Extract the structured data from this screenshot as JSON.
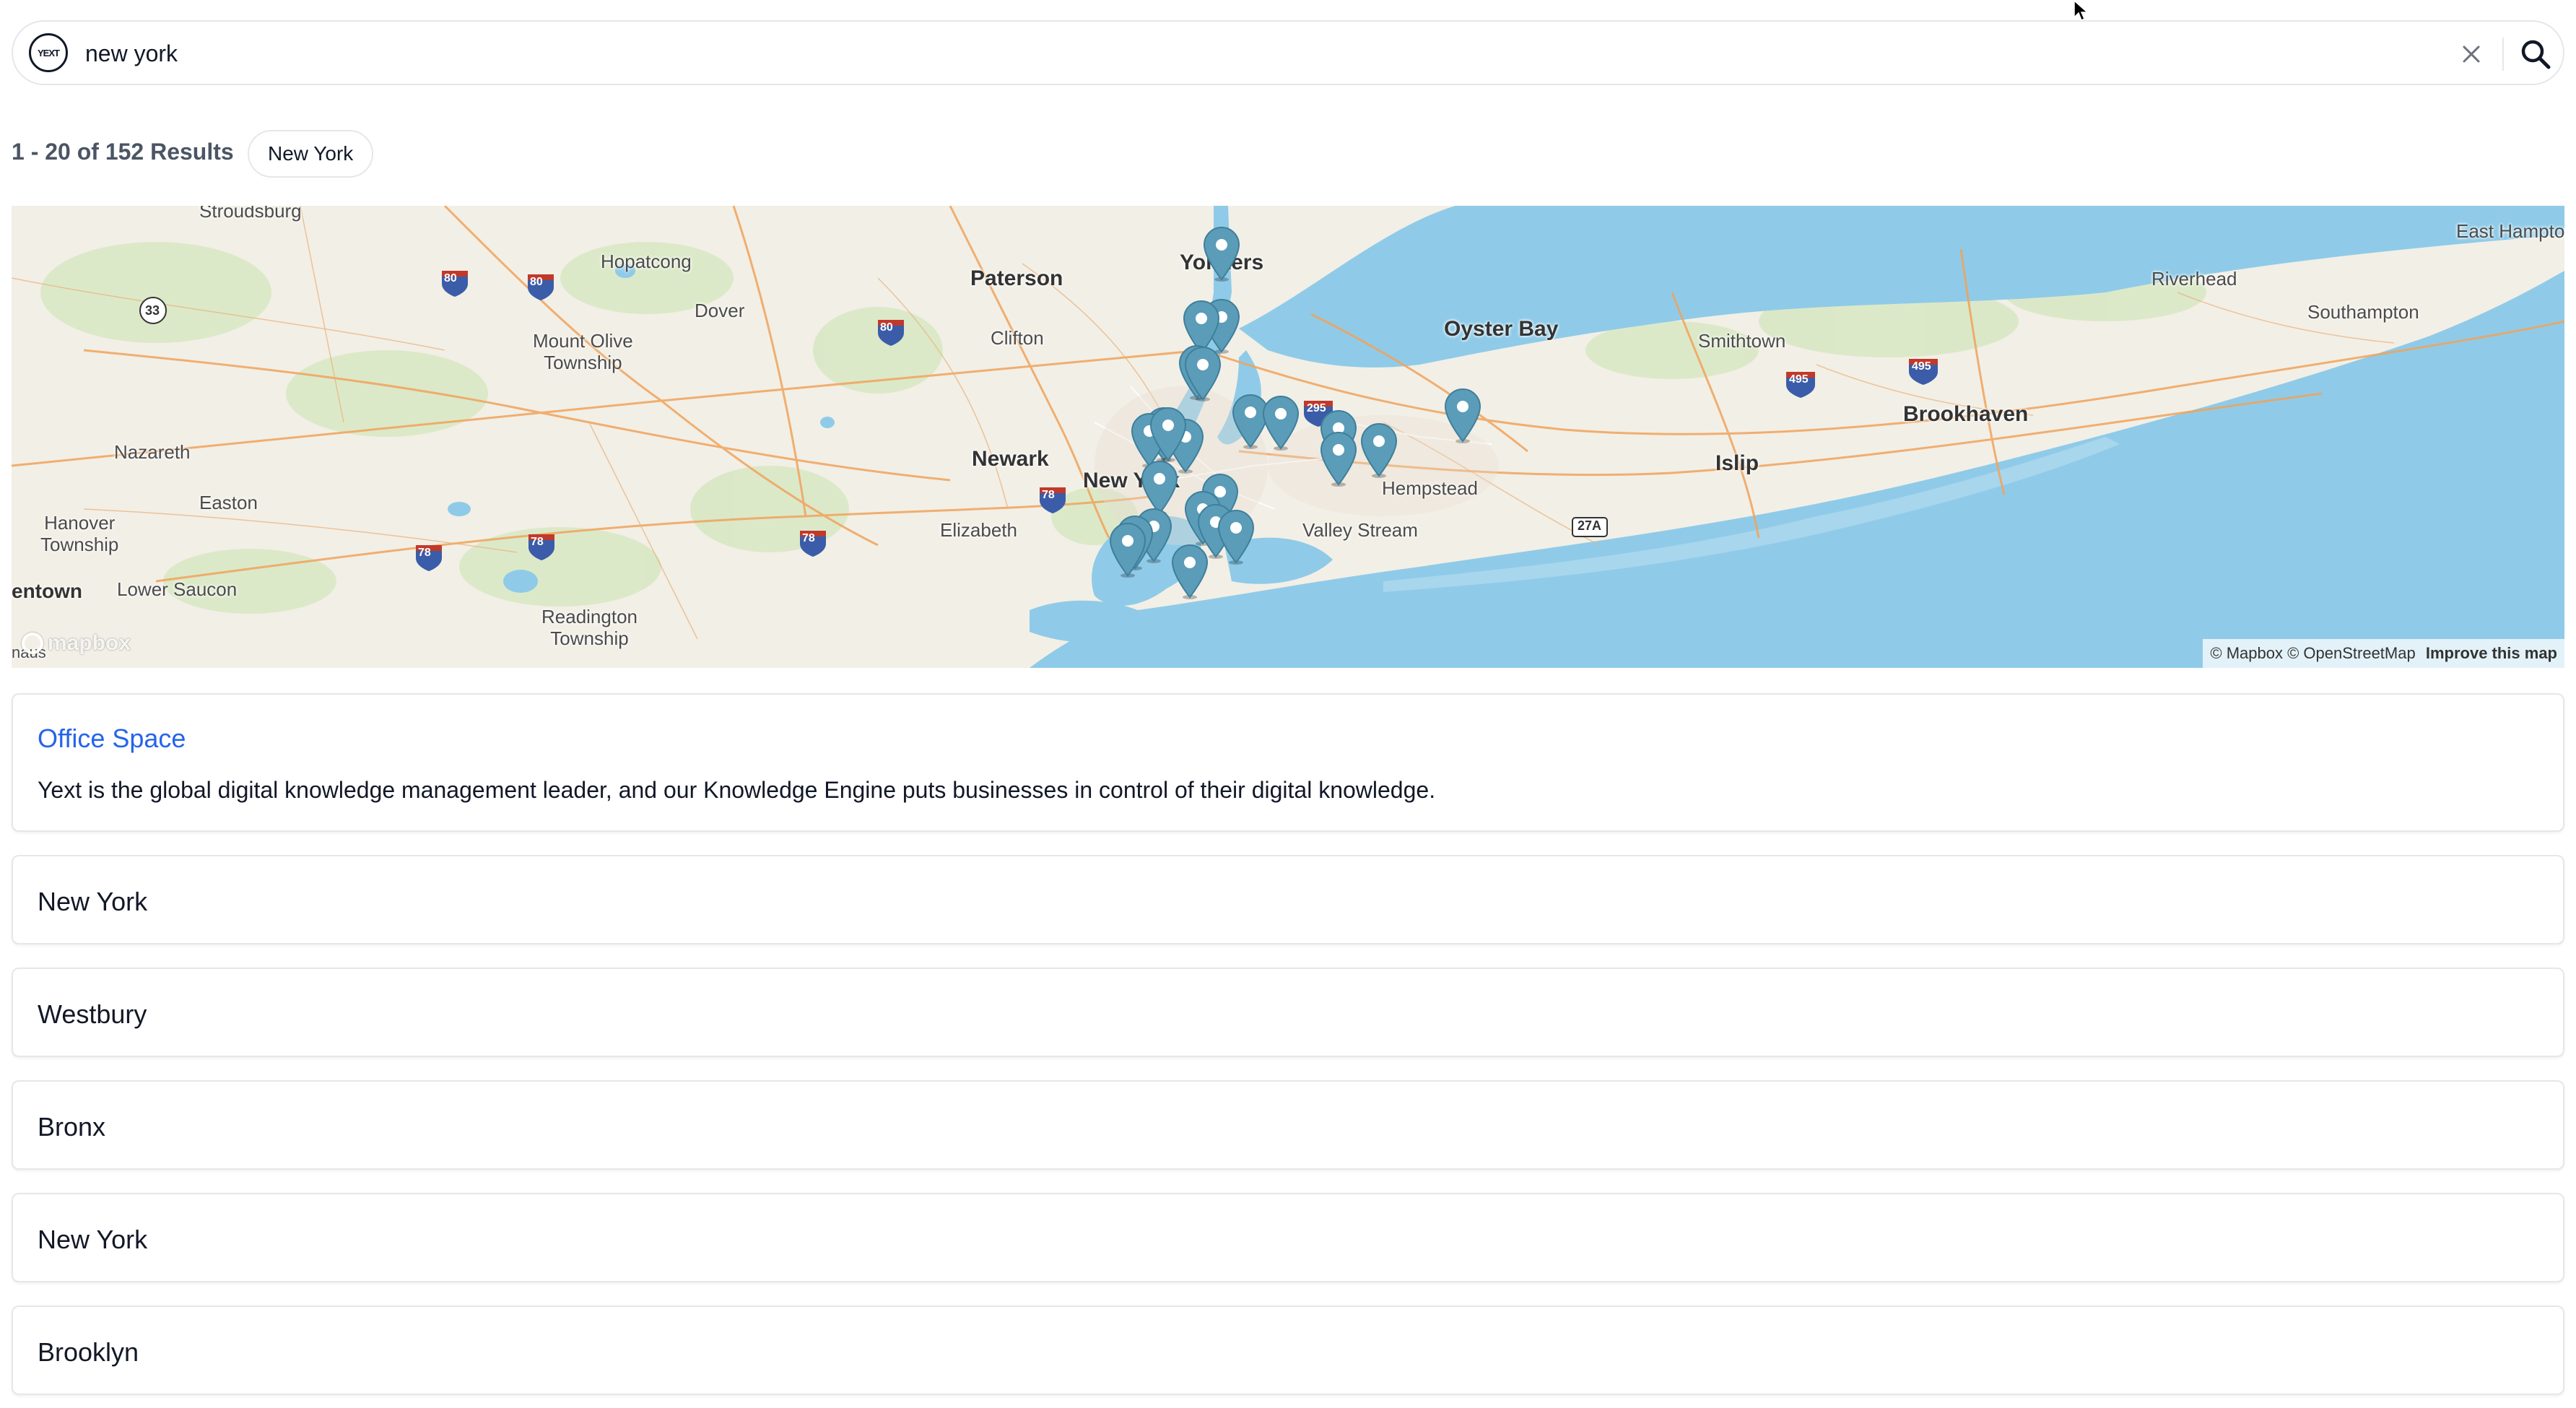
{
  "search": {
    "logo_text": "YEXT",
    "query": "new york"
  },
  "results": {
    "count_label": "1 - 20 of 152 Results",
    "filter_chip": "New York"
  },
  "map": {
    "places": [
      {
        "label": "Stroudsburg",
        "style": "normal"
      },
      {
        "label": "Hopatcong",
        "style": "normal"
      },
      {
        "label": "Paterson",
        "style": "big"
      },
      {
        "label": "Yonkers",
        "style": "big"
      },
      {
        "label": "Dover",
        "style": "normal"
      },
      {
        "label": "Mount Olive\nTownship",
        "style": "normal"
      },
      {
        "label": "Clifton",
        "style": "normal"
      },
      {
        "label": "Oyster Bay",
        "style": "big"
      },
      {
        "label": "Smithtown",
        "style": "normal"
      },
      {
        "label": "Riverhead",
        "style": "normal"
      },
      {
        "label": "Southampton",
        "style": "normal"
      },
      {
        "label": "East Hampton",
        "style": "normal"
      },
      {
        "label": "Nazareth",
        "style": "normal"
      },
      {
        "label": "Newark",
        "style": "big"
      },
      {
        "label": "New York",
        "style": "big"
      },
      {
        "label": "Hempstead",
        "style": "normal"
      },
      {
        "label": "Brookhaven",
        "style": "big"
      },
      {
        "label": "Islip",
        "style": "big"
      },
      {
        "label": "Easton",
        "style": "normal"
      },
      {
        "label": "Hanover\nTownship",
        "style": "normal"
      },
      {
        "label": "Elizabeth",
        "style": "normal"
      },
      {
        "label": "Valley Stream",
        "style": "normal"
      },
      {
        "label": "entown",
        "style": "bold"
      },
      {
        "label": "Lower Saucon",
        "style": "normal"
      },
      {
        "label": "Readington\nTownship",
        "style": "normal"
      },
      {
        "label": "naus",
        "style": "normal"
      }
    ],
    "shields": [
      "80",
      "80",
      "80",
      "33",
      "78",
      "78",
      "78",
      "78",
      "295",
      "495",
      "495",
      "27A"
    ],
    "attribution": "© Mapbox © OpenStreetMap",
    "improve_link": "Improve this map",
    "logo": "mapbox",
    "marker_color": "#5b9cb8",
    "water_color": "#8fcbe8",
    "land_color": "#f2efe6",
    "marker_count": 24
  },
  "cards": [
    {
      "title": "Office Space",
      "description": "Yext is the global digital knowledge management leader, and our Knowledge Engine puts businesses in control of their digital knowledge.",
      "is_link": true
    },
    {
      "title": "New York"
    },
    {
      "title": "Westbury"
    },
    {
      "title": "Bronx"
    },
    {
      "title": "New York"
    },
    {
      "title": "Brooklyn"
    }
  ],
  "colors": {
    "link": "#2563eb",
    "border": "#e5e7eb",
    "muted_text": "#4b5563"
  }
}
